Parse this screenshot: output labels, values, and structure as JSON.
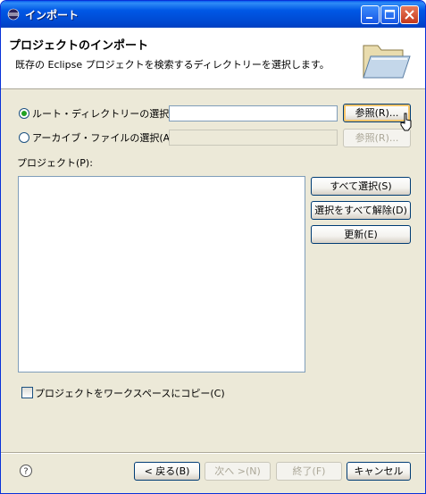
{
  "window": {
    "title": "インポート"
  },
  "banner": {
    "title": "プロジェクトのインポート",
    "description": "既存の Eclipse プロジェクトを検索するディレクトリーを選択します。",
    "icon": "folder-icon"
  },
  "options": {
    "root_dir_label": "ルート・ディレクトリーの選択(T):",
    "root_dir_value": "",
    "archive_label": "アーカイブ・ファイルの選択(A):",
    "archive_value": "",
    "browse_label": "参照(R)...",
    "selected": "root_dir"
  },
  "projects": {
    "label": "プロジェクト(P):",
    "items": [],
    "select_all": "すべて選択(S)",
    "deselect_all": "選択をすべて解除(D)",
    "refresh": "更新(E)"
  },
  "copy_option": {
    "label": "プロジェクトをワークスペースにコピー(C)",
    "checked": false
  },
  "footer": {
    "back": "< 戻る(B)",
    "next": "次へ >(N)",
    "finish": "終了(F)",
    "cancel": "キャンセル"
  }
}
